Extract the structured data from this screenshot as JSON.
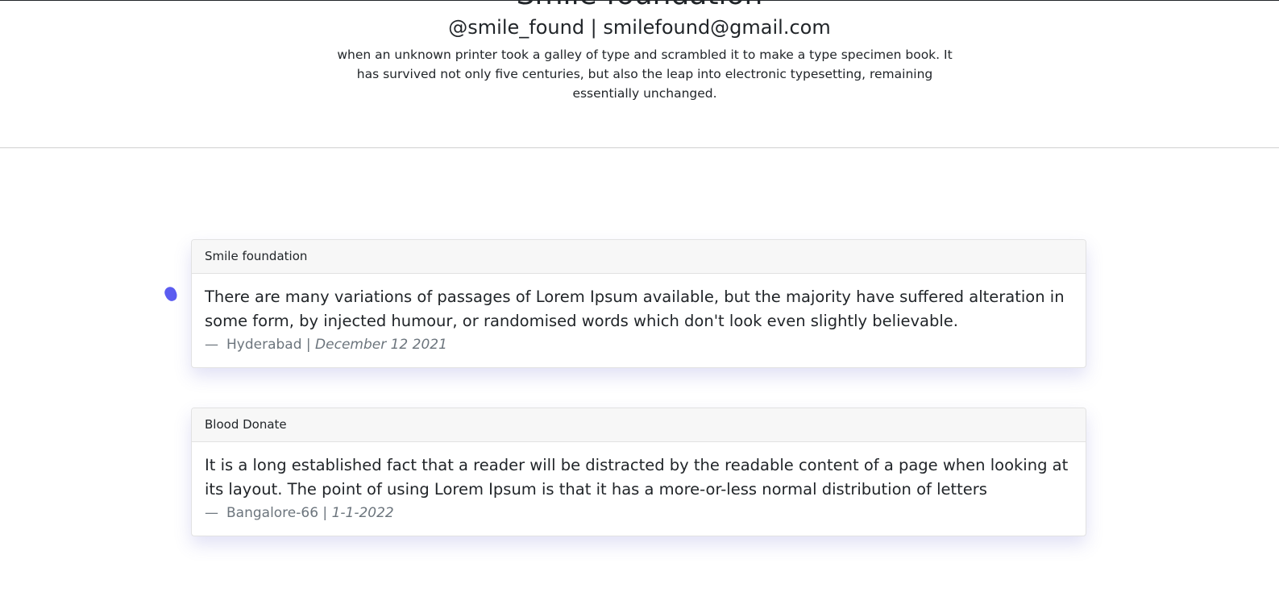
{
  "header": {
    "title": "Smile foundation",
    "contact": "@smile_found | smilefound@gmail.com",
    "intro": "when an unknown printer took a galley of type and scrambled it to make a type specimen book. It has survived not only five centuries, but also the leap into electronic typesetting, remaining essentially unchanged."
  },
  "cards": [
    {
      "header": "Smile foundation",
      "text": "There are many variations of passages of Lorem Ipsum available, but the majority have suffered alteration in some form, by injected humour, or randomised words which don't look even slightly believable.",
      "dash": "—",
      "location": "Hyderabad | ",
      "date": "December 12 2021"
    },
    {
      "header": "Blood Donate",
      "text": "It is a long established fact that a reader will be distracted by the readable content of a page when looking at its layout. The point of using Lorem Ipsum is that it has a more-or-less normal distribution of letters",
      "dash": "—",
      "location": "Bangalore-66 | ",
      "date": "1-1-2022"
    }
  ],
  "colors": {
    "accent": "#5b5cf0",
    "muted_text": "#6c757d",
    "card_header_bg": "#f7f7f7"
  }
}
